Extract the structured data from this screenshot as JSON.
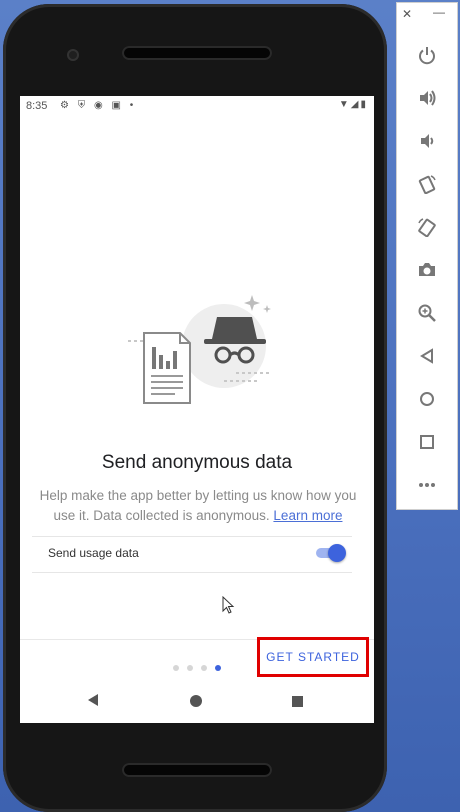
{
  "status_bar": {
    "time": "8:35",
    "left_icons": "⚙ ⛨ ◉ ▣ •",
    "right_icons": "▼◢▮"
  },
  "content": {
    "title": "Send anonymous data",
    "description": "Help make the app better by letting us know how you use it. Data collected is anonymous.",
    "learn_more": "Learn more",
    "usage_label": "Send usage data",
    "usage_enabled": true
  },
  "footer": {
    "get_started": "GET STARTED",
    "page_count": 4,
    "active_page": 4
  },
  "emulator_panel": {
    "close": "✕",
    "minimize": "—",
    "buttons": [
      "power-icon",
      "volume-up-icon",
      "volume-down-icon",
      "rotate-left-icon",
      "rotate-right-icon",
      "camera-icon",
      "zoom-icon",
      "back-icon",
      "home-icon",
      "overview-icon",
      "more-icon"
    ]
  },
  "colors": {
    "accent": "#3d63dd",
    "highlight_box": "#e00000",
    "desktop": "#4a6fbd"
  }
}
